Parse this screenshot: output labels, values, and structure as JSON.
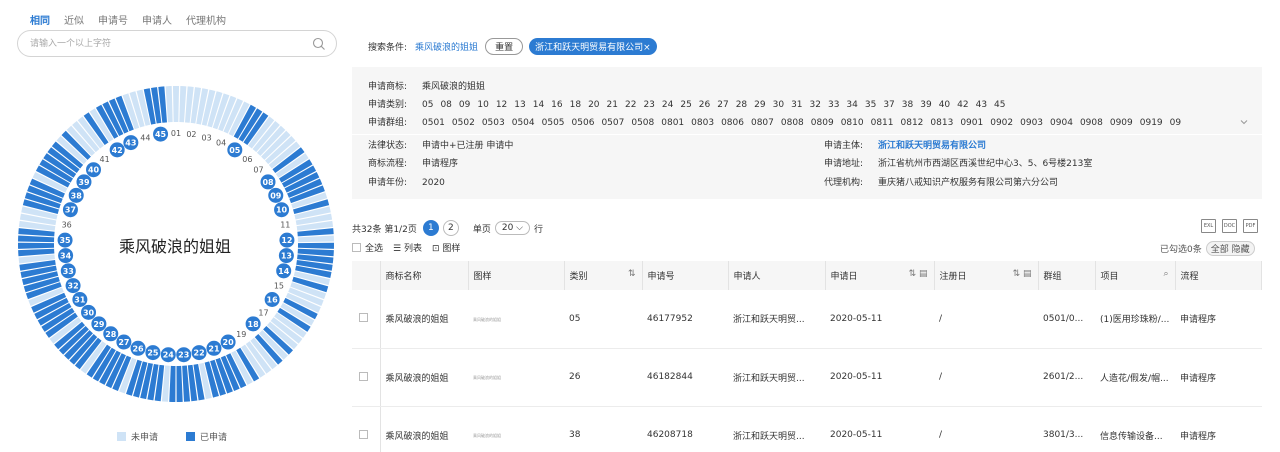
{
  "tabs": [
    "相同",
    "近似",
    "申请号",
    "申请人",
    "代理机构"
  ],
  "search": {
    "placeholder": "请输入一个以上字符"
  },
  "trademark_name": "乘风破浪的姐姐",
  "ring": {
    "applied": [
      "01",
      "02",
      "03",
      "04",
      "05",
      "06",
      "07",
      "08",
      "09",
      "10",
      "11",
      "12",
      "13",
      "14",
      "15",
      "16",
      "17",
      "18",
      "19",
      "20",
      "21",
      "22",
      "23",
      "24",
      "25",
      "26",
      "27",
      "28",
      "29",
      "30",
      "31",
      "32",
      "33",
      "34",
      "35",
      "36",
      "37",
      "38",
      "39",
      "40",
      "41",
      "42",
      "43",
      "44",
      "45"
    ],
    "highlighted": [
      "05",
      "08",
      "09",
      "10",
      "12",
      "13",
      "14",
      "16",
      "18",
      "20",
      "21",
      "22",
      "23",
      "24",
      "25",
      "26",
      "27",
      "28",
      "29",
      "30",
      "31",
      "32",
      "33",
      "34",
      "35",
      "37",
      "38",
      "39",
      "40",
      "42",
      "43",
      "45"
    ],
    "colors": {
      "applied": "#2c7bd2",
      "unapplied": "#cfe3f6"
    }
  },
  "legend": {
    "unapplied": "未申请",
    "applied": "已申请"
  },
  "conditions": {
    "label": "搜索条件:",
    "value": "乘风破浪的姐姐",
    "reset": "重置",
    "chip": "浙江和跃天明贸易有限公司×"
  },
  "info": {
    "mark_label": "申请商标:",
    "mark": "乘风破浪的姐姐",
    "class_label": "申请类别:",
    "classes": [
      "05",
      "08",
      "09",
      "10",
      "12",
      "13",
      "14",
      "16",
      "18",
      "20",
      "21",
      "22",
      "23",
      "24",
      "25",
      "26",
      "27",
      "28",
      "29",
      "30",
      "31",
      "32",
      "33",
      "34",
      "35",
      "37",
      "38",
      "39",
      "40",
      "42",
      "43",
      "45"
    ],
    "group_label": "申请群组:",
    "groups": [
      "0501",
      "0502",
      "0503",
      "0504",
      "0505",
      "0506",
      "0507",
      "0508",
      "0801",
      "0803",
      "0806",
      "0807",
      "0808",
      "0809",
      "0810",
      "0811",
      "0812",
      "0813",
      "0901",
      "0902",
      "0903",
      "0904",
      "0908",
      "0909",
      "0919",
      "09"
    ],
    "status_label": "法律状态:",
    "status": "申请中+已注册   申请中",
    "flow_label": "商标流程:",
    "flow": "申请程序",
    "year_label": "申请年份:",
    "year": "2020",
    "owner_label": "申请主体:",
    "owner": "浙江和跃天明贸易有限公司",
    "addr_label": "申请地址:",
    "addr": "浙江省杭州市西湖区西溪世纪中心3、5、6号楼213室",
    "agent_label": "代理机构:",
    "agent": "重庆猪八戒知识产权服务有限公司第六分公司"
  },
  "pager": {
    "total": "共32条",
    "page": "第1/2页",
    "current": "1",
    "next": "2",
    "per_label": "单页",
    "per": "20",
    "row_unit": "行"
  },
  "tools": {
    "select_all": "全选",
    "list": "列表",
    "image": "图样"
  },
  "exports": [
    "EXL",
    "DOC",
    "PDF"
  ],
  "selection": {
    "text": "已勾选0条",
    "all": "全部",
    "hide": "隐藏"
  },
  "table": {
    "headers": [
      "商标名称",
      "图样",
      "类别",
      "申请号",
      "申请人",
      "申请日",
      "注册日",
      "群组",
      "项目",
      "流程"
    ],
    "rows": [
      {
        "name": "乘风破浪的姐姐",
        "cls": "05",
        "no": "46177952",
        "applicant": "浙江和跃天明贸...",
        "date": "2020-05-11",
        "reg": "/",
        "group": "0501/0...",
        "item": "(1)医用珍珠粉/...",
        "flow": "申请程序"
      },
      {
        "name": "乘风破浪的姐姐",
        "cls": "26",
        "no": "46182844",
        "applicant": "浙江和跃天明贸...",
        "date": "2020-05-11",
        "reg": "/",
        "group": "2601/2...",
        "item": "人造花/假发/帽...",
        "flow": "申请程序"
      },
      {
        "name": "乘风破浪的姐姐",
        "cls": "38",
        "no": "46208718",
        "applicant": "浙江和跃天明贸...",
        "date": "2020-05-11",
        "reg": "/",
        "group": "3801/3...",
        "item": "信息传输设备...",
        "flow": "申请程序"
      }
    ]
  }
}
